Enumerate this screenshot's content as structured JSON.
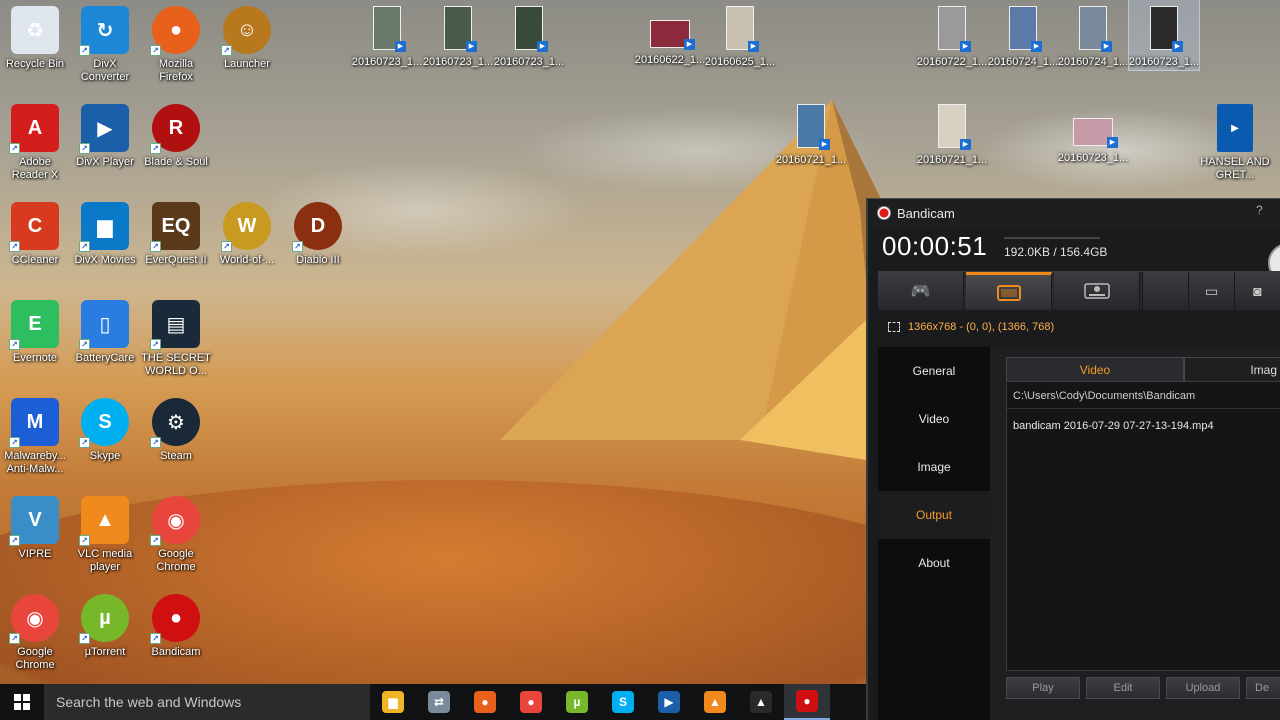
{
  "desktop": {
    "icons": [
      {
        "label": "Recycle Bin",
        "icon": "recycle-bin-icon",
        "color": "#dfe6ee"
      },
      {
        "label": "DivX Converter",
        "icon": "divx-converter-icon",
        "color": "#1e88d8"
      },
      {
        "label": "Mozilla Firefox",
        "icon": "firefox-icon",
        "color": "#e8601c"
      },
      {
        "label": "Launcher",
        "icon": "launcher-icon",
        "color": "#b8781e"
      },
      {
        "label": "Adobe Reader X",
        "icon": "adobe-reader-icon",
        "color": "#d41e1e"
      },
      {
        "label": "DivX Player",
        "icon": "divx-player-icon",
        "color": "#1a5fa8"
      },
      {
        "label": "Blade & Soul",
        "icon": "blade-soul-icon",
        "color": "#b01010"
      },
      {
        "label": "CCleaner",
        "icon": "ccleaner-icon",
        "color": "#d83a20"
      },
      {
        "label": "DivX Movies",
        "icon": "divx-movies-icon",
        "color": "#0a7ac8"
      },
      {
        "label": "EverQuest II",
        "icon": "everquest-icon",
        "color": "#5a3a1a"
      },
      {
        "label": "World-of-...",
        "icon": "world-of-warcraft-icon",
        "color": "#c89a20"
      },
      {
        "label": "Diablo III",
        "icon": "diablo-icon",
        "color": "#8a3010"
      },
      {
        "label": "Evernote",
        "icon": "evernote-icon",
        "color": "#2dbe60"
      },
      {
        "label": "BatteryCare",
        "icon": "batterycare-icon",
        "color": "#2a7de0"
      },
      {
        "label": "THE SECRET WORLD O...",
        "icon": "video-file-icon",
        "color": "#1a2a3a"
      },
      {
        "label": "Malwareby... Anti-Malw...",
        "icon": "malwarebytes-icon",
        "color": "#1c5ed6"
      },
      {
        "label": "Skype",
        "icon": "skype-icon",
        "color": "#00aff0"
      },
      {
        "label": "Steam",
        "icon": "steam-icon",
        "color": "#1b2838"
      },
      {
        "label": "VIPRE",
        "icon": "vipre-icon",
        "color": "#3a8ec8"
      },
      {
        "label": "VLC media player",
        "icon": "vlc-icon",
        "color": "#f08a1c"
      },
      {
        "label": "Google Chrome",
        "icon": "chrome-icon",
        "color": "#e8453c"
      },
      {
        "label": "Google Chrome",
        "icon": "chrome-icon",
        "color": "#e8453c"
      },
      {
        "label": "µTorrent",
        "icon": "utorrent-icon",
        "color": "#76b82a"
      },
      {
        "label": "Bandicam",
        "icon": "bandicam-icon",
        "color": "#d01010"
      }
    ],
    "thumbnails": [
      {
        "label": "20160723_1...",
        "color": "#6a7a6a"
      },
      {
        "label": "20160723_1...",
        "color": "#4a5a4a"
      },
      {
        "label": "20160723_1...",
        "color": "#3a4a3a"
      },
      {
        "label": "20160622_1...",
        "color": "#8a2a3a"
      },
      {
        "label": "20160625_1...",
        "color": "#c8c0b0"
      },
      {
        "label": "20160722_1...",
        "color": "#9a9a9a"
      },
      {
        "label": "20160724_1...",
        "color": "#5a7aa8"
      },
      {
        "label": "20160724_1...",
        "color": "#7a8a9a"
      },
      {
        "label": "20160723_1...",
        "color": "#2a2a2a"
      },
      {
        "label": "20160721_1...",
        "color": "#4a7aa8"
      },
      {
        "label": "20160721_1...",
        "color": "#d8d0c0"
      },
      {
        "label": "20160723_1...",
        "color": "#c89aa8"
      }
    ],
    "divx_file": {
      "label": "HANSEL AND GRET...",
      "icon": "divx-file-icon"
    }
  },
  "taskbar": {
    "search_placeholder": "Search the web and Windows",
    "apps": [
      {
        "name": "file-explorer",
        "glyph": "▆",
        "color": "#f0b429"
      },
      {
        "name": "network",
        "glyph": "⇄",
        "color": "#7a8a9a"
      },
      {
        "name": "firefox",
        "glyph": "●",
        "color": "#e8601c"
      },
      {
        "name": "chrome",
        "glyph": "●",
        "color": "#e8453c"
      },
      {
        "name": "utorrent",
        "glyph": "µ",
        "color": "#76b82a"
      },
      {
        "name": "skype",
        "glyph": "S",
        "color": "#00aff0"
      },
      {
        "name": "divx",
        "glyph": "▶",
        "color": "#1a5fa8"
      },
      {
        "name": "vlc",
        "glyph": "▲",
        "color": "#f08a1c"
      },
      {
        "name": "photos",
        "glyph": "▲",
        "color": "#2a2a2a"
      },
      {
        "name": "bandicam",
        "glyph": "●",
        "color": "#d01010"
      }
    ]
  },
  "bandicam": {
    "title": "Bandicam",
    "help": "?",
    "timer": "00:00:51",
    "size": "192.0KB / 156.4GB",
    "region": "1366x768 - (0, 0), (1366, 768)",
    "nav": [
      "General",
      "Video",
      "Image",
      "Output",
      "About"
    ],
    "subtabs": [
      "Video",
      "Imag"
    ],
    "folder": "C:\\Users\\Cody\\Documents\\Bandicam",
    "file": "bandicam 2016-07-29 07-27-13-194.mp4",
    "actions": [
      "Play",
      "Edit",
      "Upload",
      "De"
    ],
    "accent": "#f39a2b"
  }
}
